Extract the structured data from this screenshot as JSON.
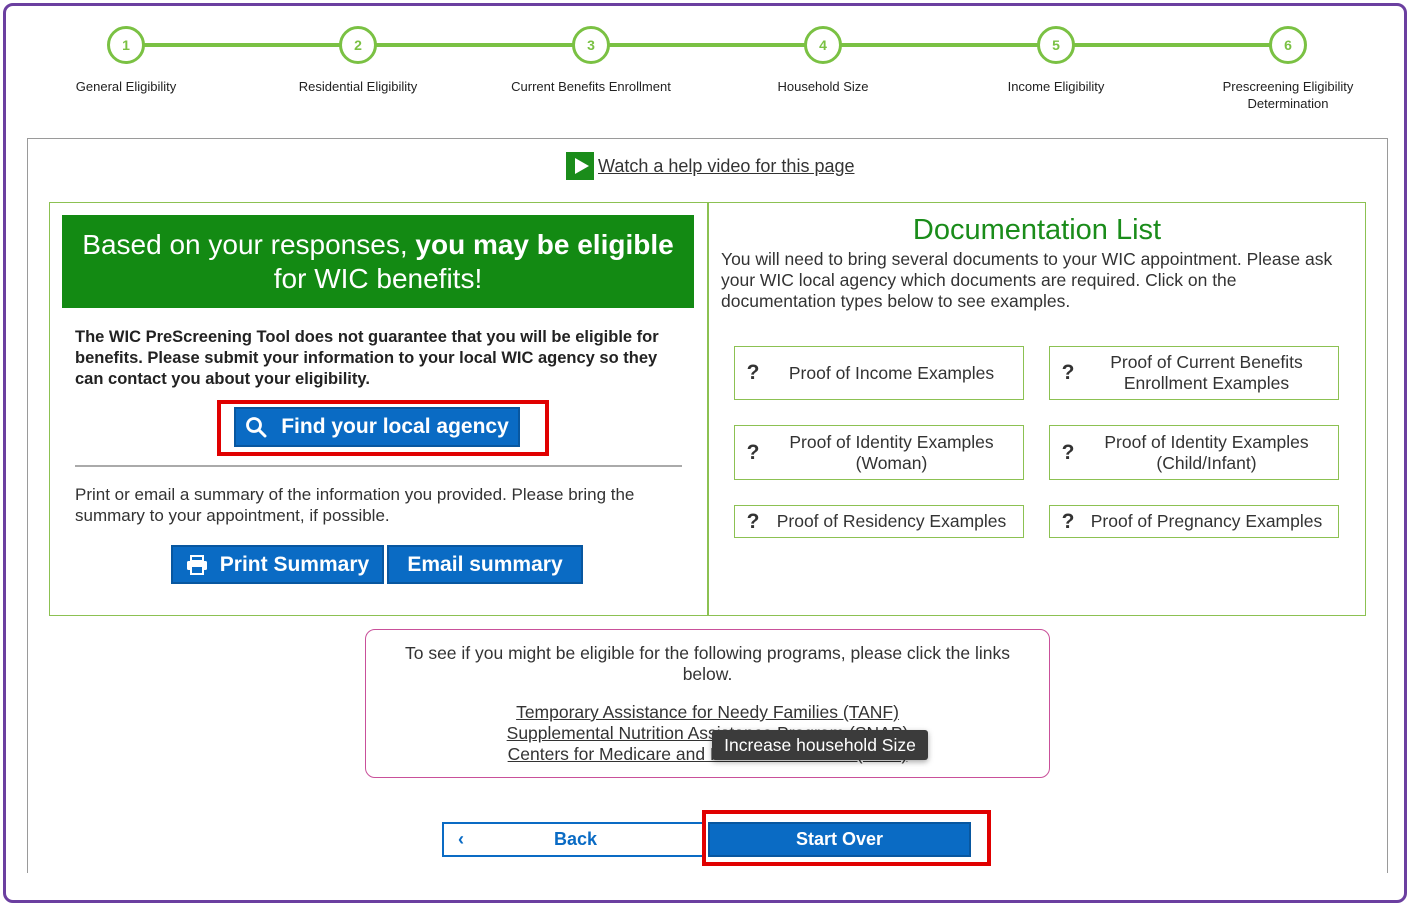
{
  "steps": [
    {
      "number": "1",
      "label": "General Eligibility"
    },
    {
      "number": "2",
      "label": "Residential Eligibility"
    },
    {
      "number": "3",
      "label": "Current Benefits Enrollment"
    },
    {
      "number": "4",
      "label": "Household Size"
    },
    {
      "number": "5",
      "label": "Income Eligibility"
    },
    {
      "number": "6",
      "label": "Prescreening Eligibility Determination"
    }
  ],
  "help": {
    "link_text": "Watch a help video for this page",
    "icon": "play-icon"
  },
  "eligibility": {
    "banner_prefix": "Based on your responses, ",
    "banner_bold": "you may be eligible",
    "banner_suffix": "for WIC benefits!",
    "disclaimer": "The WIC PreScreening Tool does not guarantee that you will be eligible for benefits. Please submit your information to your local WIC agency so they can contact you about your eligibility.",
    "find_agency_label": "Find your local agency",
    "print_note": "Print or email a summary of the information you provided. Please bring the summary to your appointment, if possible.",
    "print_label": "Print Summary",
    "email_label": "Email summary"
  },
  "documentation": {
    "title": "Documentation List",
    "description": "You will need to bring several documents to your WIC appointment. Please ask your WIC local agency which documents are required. Click on the documentation types below to see examples.",
    "items": [
      {
        "label": "Proof of Income Examples"
      },
      {
        "label": "Proof of Current Benefits Enrollment Examples"
      },
      {
        "label": "Proof of Identity Examples (Woman)"
      },
      {
        "label": "Proof of Identity Examples (Child/Infant)"
      },
      {
        "label": "Proof of Residency Examples"
      },
      {
        "label": "Proof of Pregnancy Examples"
      }
    ]
  },
  "programs": {
    "intro": "To see if you might be eligible for the following programs, please click the links below.",
    "links": [
      "Temporary Assistance for Needy Families (TANF)",
      "Supplemental Nutrition Assistance Program (SNAP)",
      "Centers for Medicare and Medicaid Services (CMS)"
    ]
  },
  "tooltip": {
    "text": "Increase household Size"
  },
  "nav": {
    "back_label": "Back",
    "start_over_label": "Start Over"
  },
  "colors": {
    "primary_blue": "#0a6bc4",
    "green": "#138a13",
    "step_green": "#7ac143",
    "highlight_red": "#e00000",
    "frame_purple": "#6b3fa0"
  }
}
